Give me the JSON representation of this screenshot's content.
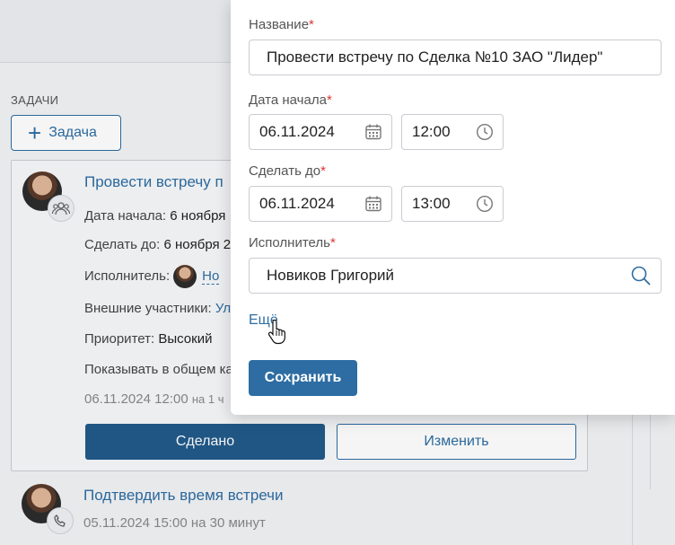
{
  "tasks_section": {
    "title": "ЗАДАЧИ",
    "add_button": "Задача"
  },
  "task_card": {
    "title": "Провести встречу п",
    "start_label": "Дата начала:",
    "start_value": "6 ноября",
    "due_label": "Сделать до:",
    "due_value": "6 ноября 2",
    "assignee_label": "Исполнитель:",
    "assignee_value": "Но",
    "external_label": "Внешние участники:",
    "external_value": "Ул",
    "priority_label": "Приоритет:",
    "priority_value": "Высокий",
    "calendar_label": "Показывать в общем ка",
    "schedule": "06.11.2024 12:00",
    "schedule_duration": "на 1 ч",
    "done_button": "Сделано",
    "edit_button": "Изменить"
  },
  "next_task": {
    "title": "Подтвердить время встречи",
    "schedule": "05.11.2024 15:00",
    "duration": "на 30 минут"
  },
  "form": {
    "name_label": "Название",
    "name_value": "Провести встречу по Сделка №10 ЗАО \"Лидер\"",
    "start_label": "Дата начала",
    "start_date": "06.11.2024",
    "start_time": "12:00",
    "due_label": "Сделать до",
    "due_date": "06.11.2024",
    "due_time": "13:00",
    "assignee_label": "Исполнитель",
    "assignee_value": "Новиков Григорий",
    "required_mark": "*",
    "more_link": "Ещё",
    "save_button": "Сохранить"
  },
  "colors": {
    "accent": "#2d6da3",
    "primary_dark": "#215a8a",
    "required": "#dd3333"
  }
}
